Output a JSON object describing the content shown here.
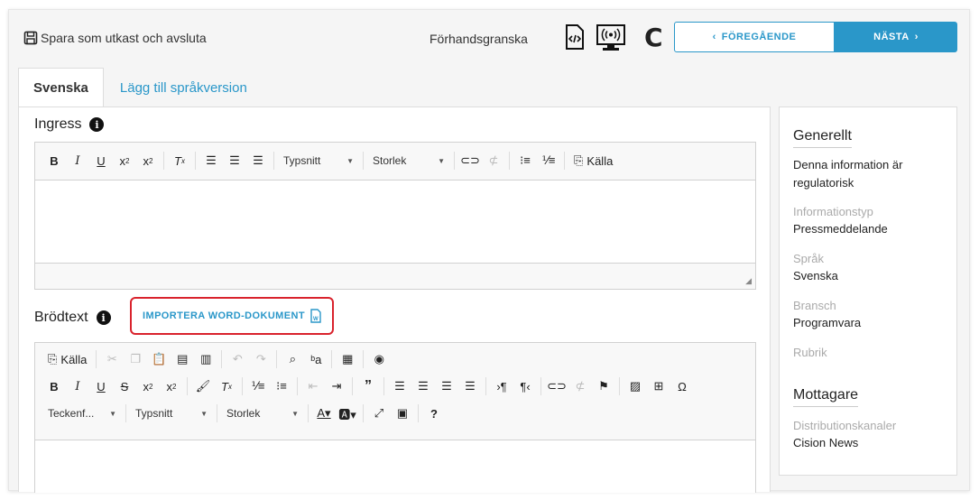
{
  "toolbar": {
    "save_label": "Spara som utkast och avsluta",
    "preview_label": "Förhandsgranska",
    "prev_label": "FÖREGÅENDE",
    "next_label": "NÄSTA",
    "c_label": "C"
  },
  "tabs": [
    {
      "label": "Svenska"
    },
    {
      "label": "Lägg till språkversion"
    }
  ],
  "ingress": {
    "label": "Ingress",
    "font_combo": "Typsnitt",
    "size_combo": "Storlek",
    "source_label": "Källa"
  },
  "brodtext": {
    "label": "Brödtext",
    "import_label": "IMPORTERA WORD-DOKUMENT",
    "source_label": "Källa",
    "format_combo": "Teckenf...",
    "font_combo": "Typsnitt",
    "size_combo": "Storlek"
  },
  "sidebar": {
    "general_title": "Generellt",
    "regulatory_text": "Denna information är regulatorisk",
    "info_type_label": "Informationstyp",
    "info_type_value": "Pressmeddelande",
    "language_label": "Språk",
    "language_value": "Svenska",
    "industry_label": "Bransch",
    "industry_value": "Programvara",
    "heading_label": "Rubrik",
    "recipients_title": "Mottagare",
    "channels_label": "Distributionskanaler",
    "channels_value": "Cision News"
  },
  "colors": {
    "accent": "#2a97c9",
    "highlight": "#d9232d"
  }
}
